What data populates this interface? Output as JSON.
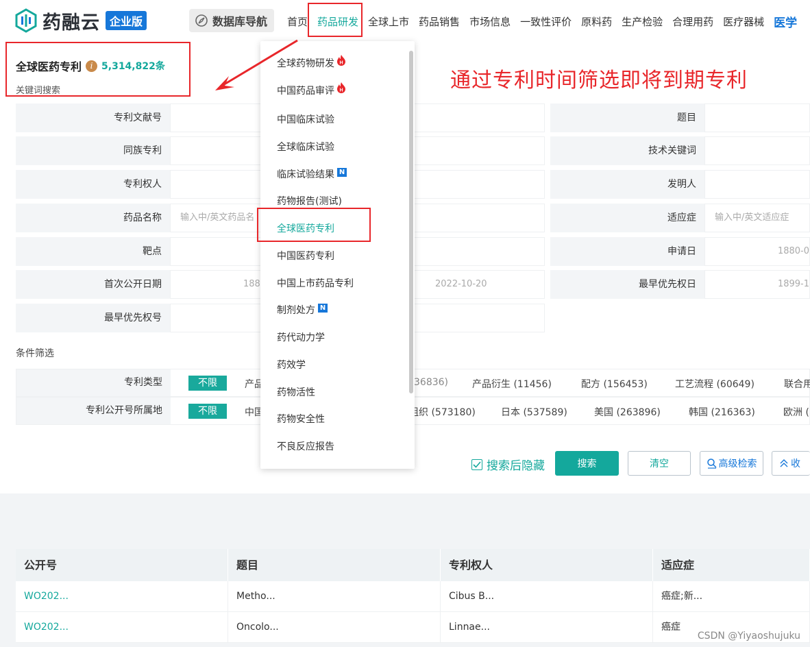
{
  "brand": {
    "name": "药融云",
    "badge": "企业版"
  },
  "db_nav_label": "数据库导航",
  "nav": [
    "首页",
    "药品研发",
    "全球上市",
    "药品销售",
    "市场信息",
    "一致性评价",
    "原料药",
    "生产检验",
    "合理用药",
    "医疗器械",
    "医学"
  ],
  "page_title": "全球医药专利",
  "record_count": "5,314,822条",
  "subtitle": "关键词搜索",
  "annotation": "通过专利时间筛选即将到期专利",
  "left_fields": [
    {
      "label": "专利文献号",
      "value": ""
    },
    {
      "label": "同族专利",
      "value": ""
    },
    {
      "label": "专利权人",
      "value": ""
    },
    {
      "label": "药品名称",
      "placeholder": "输入中/英文药品名"
    },
    {
      "label": "靶点",
      "value": ""
    },
    {
      "label": "首次公开日期",
      "from": "188",
      "to": "2022-10-20"
    },
    {
      "label": "最早优先权号",
      "value": ""
    }
  ],
  "right_fields": [
    {
      "label": "题目",
      "value": ""
    },
    {
      "label": "技术关键词",
      "value": ""
    },
    {
      "label": "发明人",
      "value": ""
    },
    {
      "label": "适应症",
      "placeholder": "输入中/英文适应症"
    },
    {
      "label": "申请日",
      "from": "1880-0"
    },
    {
      "label": "最早优先权日",
      "from": "1899-1"
    }
  ],
  "filter_section": "条件筛选",
  "filters": [
    {
      "label": "专利类型",
      "tag": "不限",
      "options": [
        "产品",
        "36836)",
        "产品衍生 (11456)",
        "配方 (156453)",
        "工艺流程 (60649)",
        "联合用"
      ]
    },
    {
      "label": "专利公开号所属地",
      "tag": "不限",
      "options": [
        "中国",
        "组织 (573180)",
        "日本 (537589)",
        "美国 (263896)",
        "韩国 (216363)",
        "欧洲 ("
      ]
    }
  ],
  "actions": {
    "hide_after_search": "搜索后隐藏",
    "search": "搜索",
    "clear": "清空",
    "advanced": "高级检索",
    "collapse": "收"
  },
  "dropdown": [
    {
      "label": "全球药物研发",
      "badge": "hot"
    },
    {
      "label": "中国药品审评",
      "badge": "hot"
    },
    {
      "label": "中国临床试验"
    },
    {
      "label": "全球临床试验"
    },
    {
      "label": "临床试验结果",
      "badge": "N"
    },
    {
      "label": "药物报告(测试)"
    },
    {
      "label": "全球医药专利",
      "active": true
    },
    {
      "label": "中国医药专利"
    },
    {
      "label": "中国上市药品专利"
    },
    {
      "label": "制剂处方",
      "badge": "N"
    },
    {
      "label": "药代动力学"
    },
    {
      "label": "药效学"
    },
    {
      "label": "药物活性"
    },
    {
      "label": "药物安全性"
    },
    {
      "label": "不良反应报告"
    }
  ],
  "table": {
    "columns": [
      "公开号",
      "题目",
      "专利权人",
      "适应症"
    ],
    "rows": [
      [
        "WO202...",
        "Metho...",
        "Cibus B...",
        "癌症;新..."
      ],
      [
        "WO202...",
        "Oncolo...",
        "Linnae...",
        "癌症"
      ]
    ]
  },
  "watermark": "CSDN @Yiyaoshujuku",
  "colors": {
    "accent": "#14a89c",
    "brand_blue": "#1677d9",
    "annotation_red": "#e8262a"
  }
}
